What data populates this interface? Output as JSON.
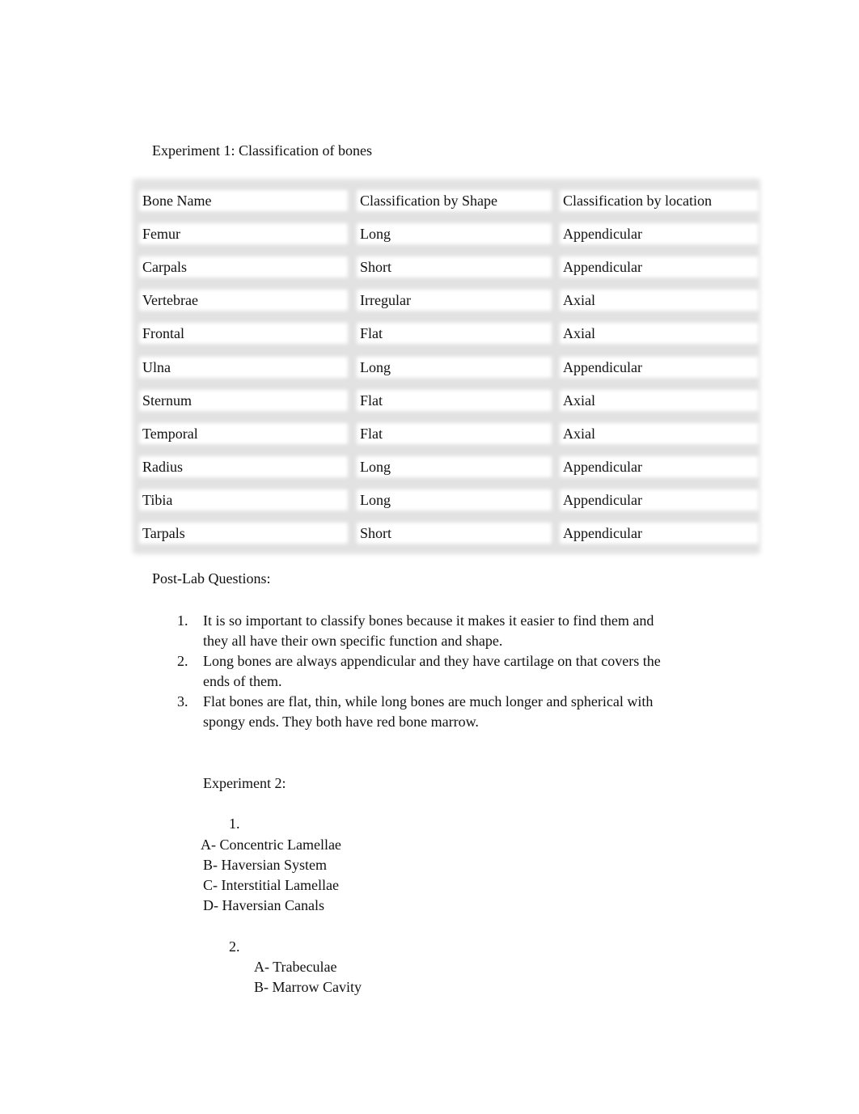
{
  "experiment1": {
    "title": "Experiment 1: Classification of bones",
    "table": {
      "headers": [
        "Bone Name",
        "Classification by Shape",
        "Classification by location"
      ],
      "rows": [
        [
          "Femur",
          "Long",
          "Appendicular"
        ],
        [
          "Carpals",
          "Short",
          "Appendicular"
        ],
        [
          "Vertebrae",
          "Irregular",
          "Axial"
        ],
        [
          "Frontal",
          "Flat",
          "Axial"
        ],
        [
          "Ulna",
          "Long",
          "Appendicular"
        ],
        [
          "Sternum",
          "Flat",
          "Axial"
        ],
        [
          "Temporal",
          "Flat",
          "Axial"
        ],
        [
          "Radius",
          "Long",
          "Appendicular"
        ],
        [
          "Tibia",
          "Long",
          "Appendicular"
        ],
        [
          "Tarpals",
          "Short",
          "Appendicular"
        ]
      ]
    }
  },
  "post_lab": {
    "title": "Post-Lab Questions:",
    "answers": [
      {
        "num": "1.",
        "lines": [
          "It is so important to classify bones because it makes it easier to find them and",
          "they all have their own specific function and shape."
        ]
      },
      {
        "num": "2.",
        "lines": [
          "Long bones are always appendicular and they have cartilage on that covers the",
          "ends of them."
        ]
      },
      {
        "num": "3.",
        "lines": [
          "Flat bones are flat, thin, while long bones are much longer and spherical with",
          "spongy ends. They both have red bone marrow."
        ]
      }
    ]
  },
  "experiment2": {
    "title": "Experiment 2:",
    "q1": {
      "num": "1.",
      "items": [
        "A- Concentric Lamellae",
        "B- Haversian System",
        "C- Interstitial Lamellae",
        "D- Haversian Canals"
      ]
    },
    "q2": {
      "num": "2.",
      "items": [
        "A- Trabeculae",
        "B- Marrow Cavity"
      ]
    }
  }
}
